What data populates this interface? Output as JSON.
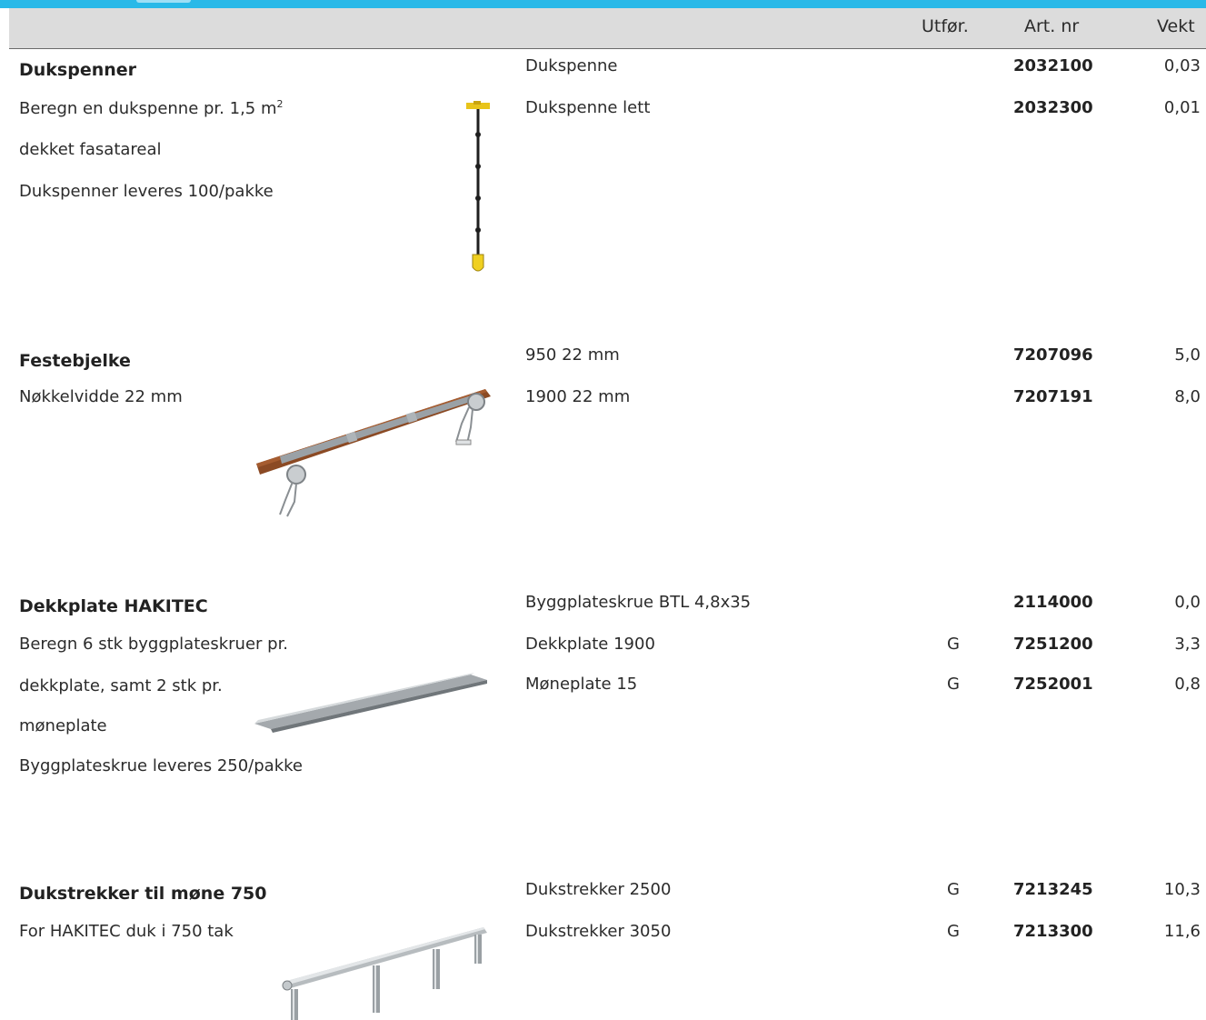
{
  "header": {
    "utfor": "Utfør.",
    "art_nr": "Art. nr",
    "vekt": "Vekt"
  },
  "sections": [
    {
      "title": "Dukspenner",
      "desc": [
        "Beregn en dukspenne pr. 1,5 m",
        "dekket fasatareal",
        "Dukspenner leveres 100/pakke"
      ],
      "desc_sup": "2",
      "image": "tarp-tensioner-image",
      "rows": [
        {
          "name": "Dukspenne",
          "utfor": "",
          "art": "2032100",
          "vekt": "0,03"
        },
        {
          "name": "Dukspenne lett",
          "utfor": "",
          "art": "2032300",
          "vekt": "0,01"
        }
      ]
    },
    {
      "title": "Festebjelke",
      "desc": [
        "Nøkkelvidde 22 mm"
      ],
      "image": "fastening-beam-image",
      "rows": [
        {
          "name": "950 22 mm",
          "utfor": "",
          "art": "7207096",
          "vekt": "5,0"
        },
        {
          "name": "1900 22 mm",
          "utfor": "",
          "art": "7207191",
          "vekt": "8,0"
        }
      ]
    },
    {
      "title": "Dekkplate HAKITEC",
      "desc": [
        "Beregn 6 stk byggplateskruer pr.",
        "dekkplate, samt 2 stk pr.",
        "møneplate",
        "Byggplateskrue leveres 250/pakke"
      ],
      "image": "cover-plate-image",
      "rows": [
        {
          "name": "Byggplateskrue BTL 4,8x35",
          "utfor": "",
          "art": "2114000",
          "vekt": "0,0"
        },
        {
          "name": "Dekkplate 1900",
          "utfor": "G",
          "art": "7251200",
          "vekt": "3,3"
        },
        {
          "name": "Møneplate 15",
          "utfor": "G",
          "art": "7252001",
          "vekt": "0,8"
        }
      ]
    },
    {
      "title": "Dukstrekker til møne 750",
      "desc": [
        "For HAKITEC duk i 750 tak"
      ],
      "image": "ridge-tarp-stretcher-image",
      "rows": [
        {
          "name": "Dukstrekker 2500",
          "utfor": "G",
          "art": "7213245",
          "vekt": "10,3"
        },
        {
          "name": "Dukstrekker 3050",
          "utfor": "G",
          "art": "7213300",
          "vekt": "11,6"
        }
      ]
    }
  ]
}
